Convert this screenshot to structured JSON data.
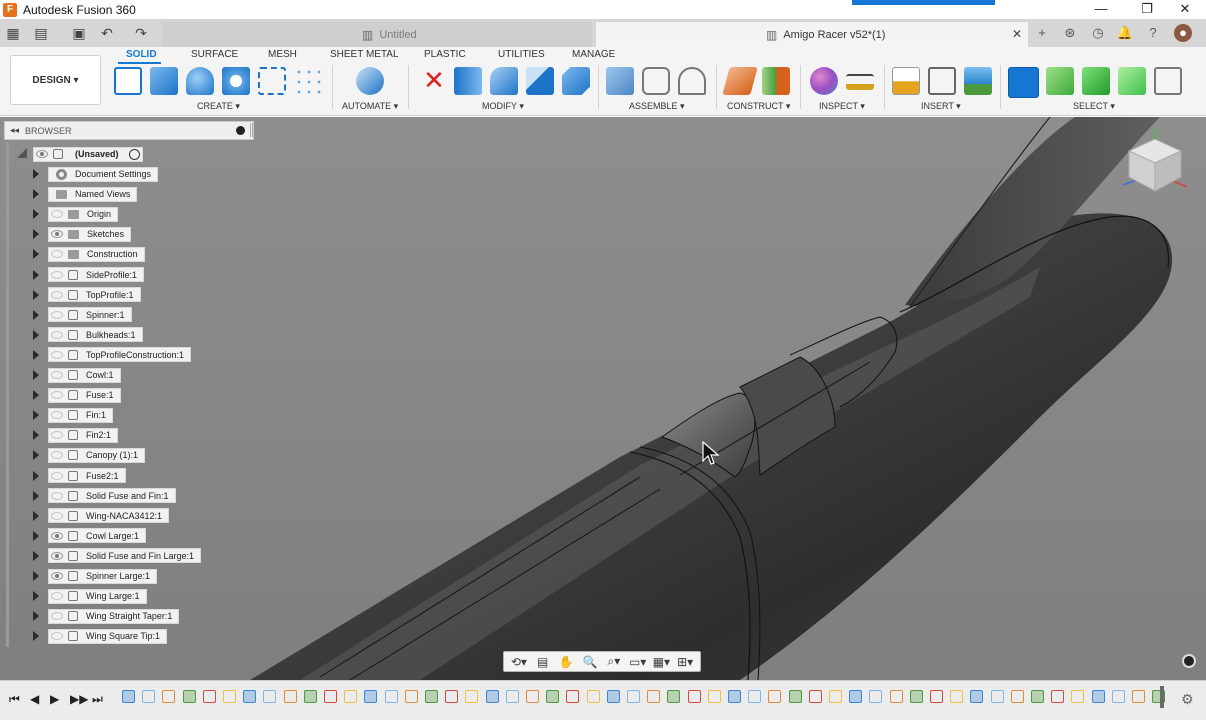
{
  "window": {
    "title": "Autodesk Fusion 360",
    "logo_letter": "F"
  },
  "tabs": [
    {
      "label": "Untitled",
      "active": false
    },
    {
      "label": "Amigo Racer v52*(1)",
      "active": true
    }
  ],
  "ribbon": {
    "workspace": "DESIGN ▾",
    "workspace_tabs": [
      "SOLID",
      "SURFACE",
      "MESH",
      "SHEET METAL",
      "PLASTIC",
      "UTILITIES",
      "MANAGE"
    ],
    "groups": [
      "CREATE ▾",
      "AUTOMATE ▾",
      "MODIFY ▾",
      "ASSEMBLE ▾",
      "CONSTRUCT ▾",
      "INSPECT ▾",
      "INSERT ▾",
      "SELECT ▾"
    ]
  },
  "browser": {
    "title": "BROWSER",
    "root": "(Unsaved)",
    "items": [
      {
        "label": "Document Settings",
        "icon": "gear-icon",
        "eye": "none"
      },
      {
        "label": "Named Views",
        "icon": "folder-icon",
        "eye": "none"
      },
      {
        "label": "Origin",
        "icon": "folder-icon",
        "eye": "off"
      },
      {
        "label": "Sketches",
        "icon": "folder-icon",
        "eye": "on"
      },
      {
        "label": "Construction",
        "icon": "folder-icon",
        "eye": "off"
      },
      {
        "label": "SideProfile:1",
        "icon": "component-icon",
        "eye": "off"
      },
      {
        "label": "TopProfile:1",
        "icon": "component-icon",
        "eye": "off"
      },
      {
        "label": "Spinner:1",
        "icon": "component-icon",
        "eye": "off"
      },
      {
        "label": "Bulkheads:1",
        "icon": "component-icon",
        "eye": "off"
      },
      {
        "label": "TopProfileConstruction:1",
        "icon": "component-icon",
        "eye": "off"
      },
      {
        "label": "Cowl:1",
        "icon": "component-icon",
        "eye": "off"
      },
      {
        "label": "Fuse:1",
        "icon": "component-icon",
        "eye": "off"
      },
      {
        "label": "Fin:1",
        "icon": "component-icon",
        "eye": "off"
      },
      {
        "label": "Fin2:1",
        "icon": "component-icon",
        "eye": "off"
      },
      {
        "label": "Canopy (1):1",
        "icon": "component-icon",
        "eye": "off"
      },
      {
        "label": "Fuse2:1",
        "icon": "component-icon",
        "eye": "off"
      },
      {
        "label": "Solid Fuse and Fin:1",
        "icon": "component-icon",
        "eye": "off"
      },
      {
        "label": "Wing-NACA3412:1",
        "icon": "component-icon",
        "eye": "off"
      },
      {
        "label": "Cowl Large:1",
        "icon": "component-icon",
        "eye": "on"
      },
      {
        "label": "Solid Fuse and Fin Large:1",
        "icon": "component-icon",
        "eye": "on"
      },
      {
        "label": "Spinner Large:1",
        "icon": "component-icon",
        "eye": "on"
      },
      {
        "label": "Wing Large:1",
        "icon": "component-icon",
        "eye": "off"
      },
      {
        "label": "Wing Straight Taper:1",
        "icon": "component-icon",
        "eye": "off"
      },
      {
        "label": "Wing Square Tip:1",
        "icon": "component-icon",
        "eye": "off"
      }
    ]
  },
  "navbar": {
    "icons": [
      "orbit-icon",
      "look-at-icon",
      "pan-icon",
      "zoom-icon",
      "fit-icon",
      "display-settings-icon",
      "grid-icon",
      "viewports-icon"
    ]
  },
  "colors": {
    "accent": "#1577d4",
    "viewport_bg": "#8a8a8a",
    "model": "#4a4a4a"
  }
}
